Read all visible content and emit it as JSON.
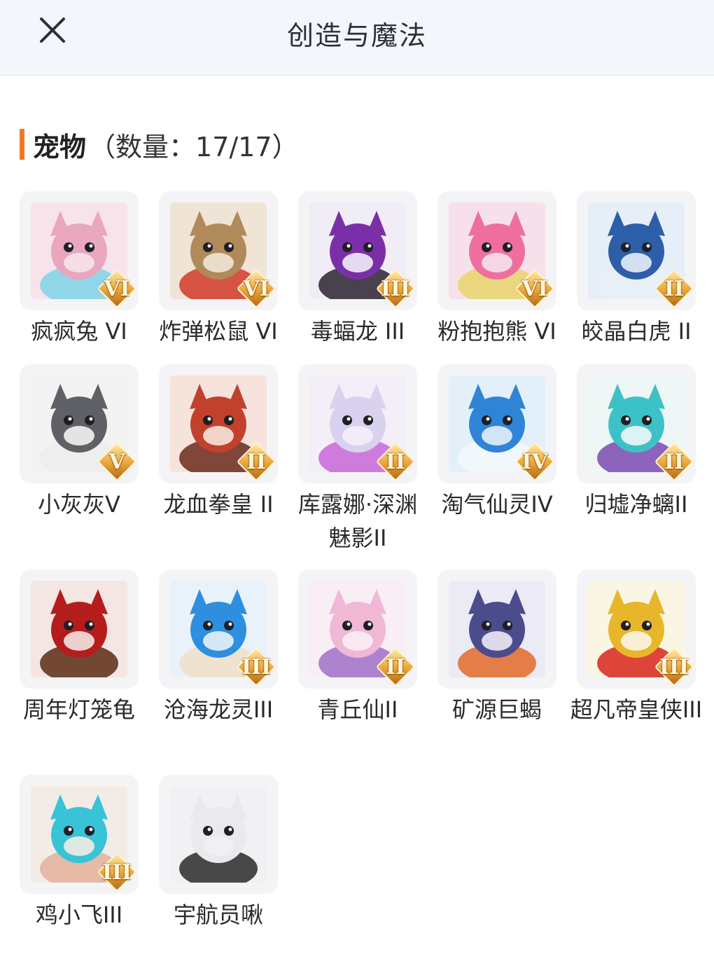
{
  "header": {
    "title": "创造与魔法",
    "close_icon": "close-icon"
  },
  "section": {
    "title": "宠物",
    "count": "（数量：17/17）",
    "accent_color": "#f07a23"
  },
  "pets": [
    {
      "name": "疯疯兔 VI",
      "rank": "VI",
      "colors": [
        "#f7e3ea",
        "#e9a6bf",
        "#7fd3e8"
      ]
    },
    {
      "name": "炸弹松鼠 VI",
      "rank": "VI",
      "colors": [
        "#efe4d6",
        "#b08a5a",
        "#d23a2a"
      ]
    },
    {
      "name": "毒蝠龙 III",
      "rank": "III",
      "colors": [
        "#f1edf6",
        "#7a2fa8",
        "#2b2230"
      ]
    },
    {
      "name": "粉抱抱熊 VI",
      "rank": "VI",
      "colors": [
        "#f6e1ea",
        "#ee6f9d",
        "#e8d36b"
      ]
    },
    {
      "name": "皎晶白虎 II",
      "rank": "II",
      "colors": [
        "#e6eef8",
        "#2d5fa8",
        "#e8eef6"
      ]
    },
    {
      "name": "小灰灰V",
      "rank": "V",
      "colors": [
        "#f3f3f3",
        "#5f6166",
        "#ececec"
      ]
    },
    {
      "name": "龙血拳皇 II",
      "rank": "II",
      "colors": [
        "#f6e3dc",
        "#c2412c",
        "#6a2a1c"
      ]
    },
    {
      "name": "库露娜·深渊魅影II",
      "rank": "II",
      "colors": [
        "#f4eef8",
        "#d8d2ee",
        "#c866d8"
      ]
    },
    {
      "name": "淘气仙灵IV",
      "rank": "IV",
      "colors": [
        "#e3f0fa",
        "#2f84d6",
        "#f4f8fb"
      ]
    },
    {
      "name": "归墟净螭II",
      "rank": "II",
      "colors": [
        "#eef7f6",
        "#3cc2c6",
        "#7a4ab0"
      ]
    },
    {
      "name": "周年灯笼龟",
      "rank": "",
      "colors": [
        "#f4e6e2",
        "#b51d1d",
        "#5a2a14"
      ]
    },
    {
      "name": "沧海龙灵III",
      "rank": "III",
      "colors": [
        "#e9f2fb",
        "#2e8fe0",
        "#f0e0c8"
      ]
    },
    {
      "name": "青丘仙II",
      "rank": "II",
      "colors": [
        "#f8eef4",
        "#f1b8d6",
        "#a070c8"
      ]
    },
    {
      "name": "矿源巨蝎",
      "rank": "",
      "colors": [
        "#eceaf4",
        "#4a4c8c",
        "#e36a2a"
      ]
    },
    {
      "name": "超凡帝皇侠III",
      "rank": "III",
      "colors": [
        "#fbf5e4",
        "#e8b62a",
        "#d8261c"
      ]
    },
    {
      "name": "鸡小飞III",
      "rank": "III",
      "colors": [
        "#f3ece6",
        "#38c3d6",
        "#e2b29a"
      ]
    },
    {
      "name": "宇航员啾",
      "rank": "",
      "colors": [
        "#f1f1f3",
        "#e9e9ee",
        "#2a2a2a"
      ]
    }
  ]
}
